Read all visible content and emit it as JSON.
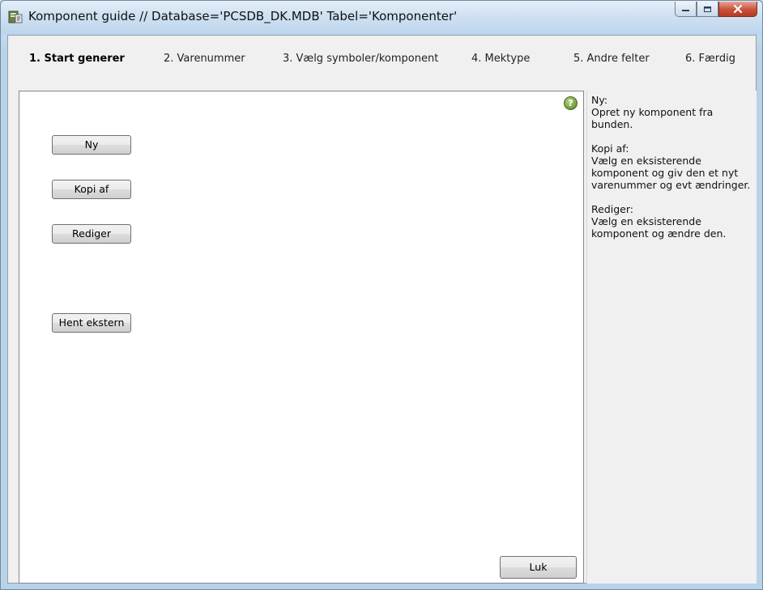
{
  "window": {
    "title": "Komponent guide // Database='PCSDB_DK.MDB' Tabel='Komponenter'",
    "app_icon": "document-wizard-icon",
    "controls": [
      "minimize-icon",
      "maximize-icon",
      "close-icon"
    ]
  },
  "steps": [
    {
      "label": "1. Start generer",
      "active": true
    },
    {
      "label": "2. Varenummer",
      "active": false
    },
    {
      "label": "3. Vælg symboler/komponent",
      "active": false
    },
    {
      "label": "4. Mektype",
      "active": false
    },
    {
      "label": "5. Andre felter",
      "active": false
    },
    {
      "label": "6. Færdig",
      "active": false
    }
  ],
  "buttons": {
    "ny": "Ny",
    "kopi_af": "Kopi af",
    "rediger": "Rediger",
    "hent_ekstern": "Hent ekstern",
    "luk": "Luk"
  },
  "help": {
    "icon": "help-question-icon",
    "blocks": [
      {
        "heading": "Ny:",
        "body": "Opret ny komponent fra bunden."
      },
      {
        "heading": "Kopi af:",
        "body": "Vælg en eksisterende komponent og giv den et nyt varenummer og evt ændringer."
      },
      {
        "heading": "Rediger:",
        "body": "Vælg en eksisterende komponent og ændre den."
      }
    ]
  },
  "colors": {
    "window_frame": "#bcd3e8",
    "client_bg": "#f0f0f0",
    "panel_bg": "#ffffff",
    "close_button": "#c9503a"
  }
}
